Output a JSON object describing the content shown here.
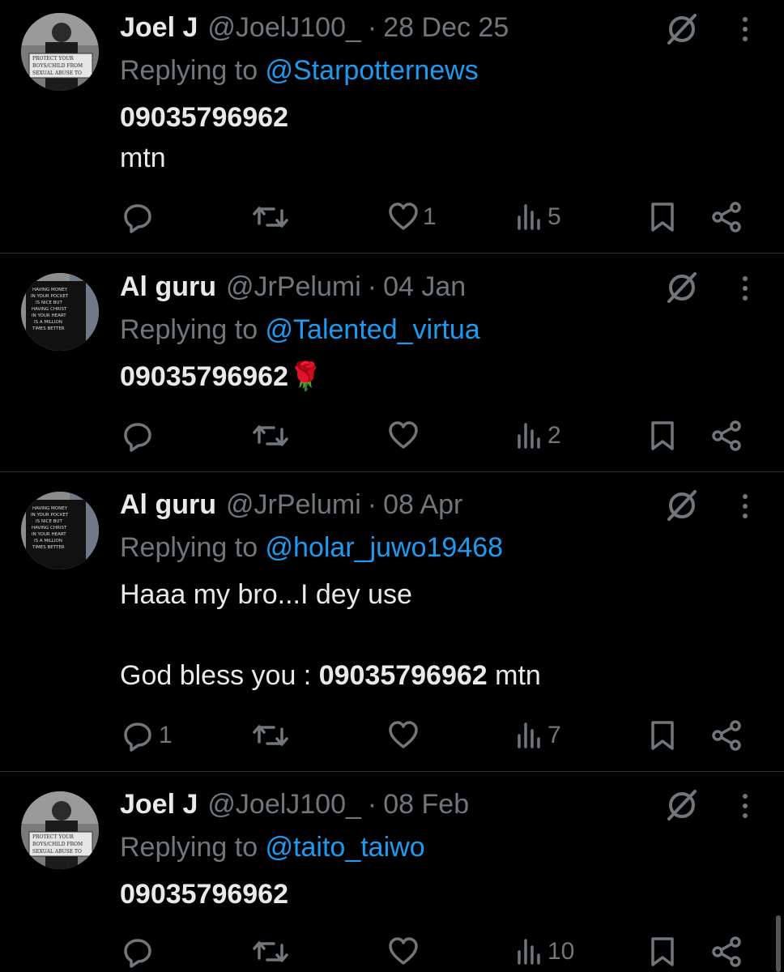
{
  "tweets": [
    {
      "name": "Joel J",
      "handle": "@JoelJ100_",
      "separator": "·",
      "date": "28 Dec 25",
      "replying_prefix": "Replying to ",
      "replying_to": "@Starpotternews",
      "lines": [
        "09035796962",
        "mtn"
      ],
      "counts": {
        "replies": "",
        "reposts": "",
        "likes": "1",
        "views": "5"
      },
      "avatar": "avatar-joel"
    },
    {
      "name": "Al guru",
      "handle": "@JrPelumi",
      "separator": "·",
      "date": "04 Jan",
      "replying_prefix": "Replying to ",
      "replying_to": "@Talented_virtua",
      "lines": [
        "09035796962🌹"
      ],
      "counts": {
        "replies": "",
        "reposts": "",
        "likes": "",
        "views": "2"
      },
      "avatar": "avatar-alguru"
    },
    {
      "name": "Al guru",
      "handle": "@JrPelumi",
      "separator": "·",
      "date": "08 Apr",
      "replying_prefix": "Replying to ",
      "replying_to": "@holar_juwo19468",
      "lines": [
        "Haaa my bro...I dey use",
        "God bless you : ",
        "09035796962",
        " mtn"
      ],
      "counts": {
        "replies": "1",
        "reposts": "",
        "likes": "",
        "views": "7"
      },
      "avatar": "avatar-alguru"
    },
    {
      "name": "Joel J",
      "handle": "@JoelJ100_",
      "separator": "·",
      "date": "08 Feb",
      "replying_prefix": "Replying to ",
      "replying_to": "@taito_taiwo",
      "lines": [
        "09035796962"
      ],
      "counts": {
        "replies": "",
        "reposts": "",
        "likes": "",
        "views": "10"
      },
      "avatar": "avatar-joel"
    }
  ],
  "avatar_sign_text": {
    "joel": [
      "PROTECT YOUR",
      "BOYS/CHILD FROM",
      "SEXUAL ABUSE TO"
    ],
    "alguru": [
      "HAVING MONEY",
      "IN YOUR POCKET",
      "IS NICE BUT",
      "HAVING CHRIST",
      "IN YOUR HEART",
      "IS A MILLION",
      "TIMES BETTER"
    ]
  },
  "icons": [
    "reply-icon",
    "repost-icon",
    "like-icon",
    "views-icon",
    "bookmark-icon",
    "share-icon",
    "grok-icon",
    "more-icon"
  ],
  "colors": {
    "background": "#000000",
    "text": "#e7e9ea",
    "muted": "#71767b",
    "link": "#1d9bf0",
    "divider": "#2f3336"
  }
}
